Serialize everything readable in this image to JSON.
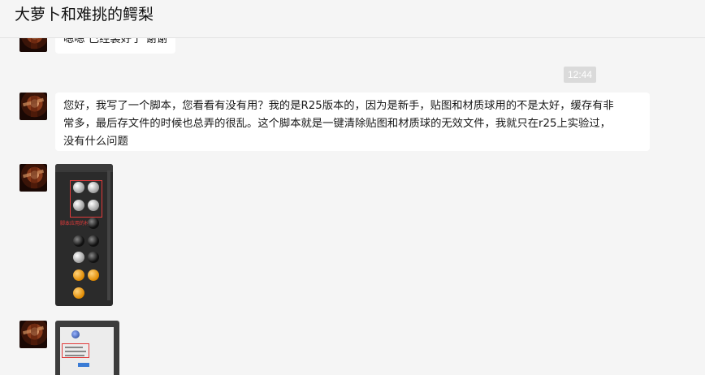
{
  "window": {
    "title": "大萝卜和难挑的鳄梨"
  },
  "messages": [
    {
      "type": "text",
      "text": "嗯嗯 已经装好了 谢谢"
    },
    {
      "type": "time",
      "text": "12:44"
    },
    {
      "type": "text",
      "line1": "您好，我写了一个脚本，您看看有没有用？我的是R25版本的，因为是新手，贴图和材质球用的不是太好，缓存有非",
      "line2": "常多，最后存文件的时候也总弄的很乱。这个脚本就是一键清除贴图和材质球的无效文件，我就只在r25上实验过，",
      "line3": "没有什么问题"
    },
    {
      "type": "image",
      "icon": "material-panel-screenshot",
      "annotation": "脚本应用的材质"
    },
    {
      "type": "image",
      "icon": "dialog-screenshot"
    }
  ]
}
